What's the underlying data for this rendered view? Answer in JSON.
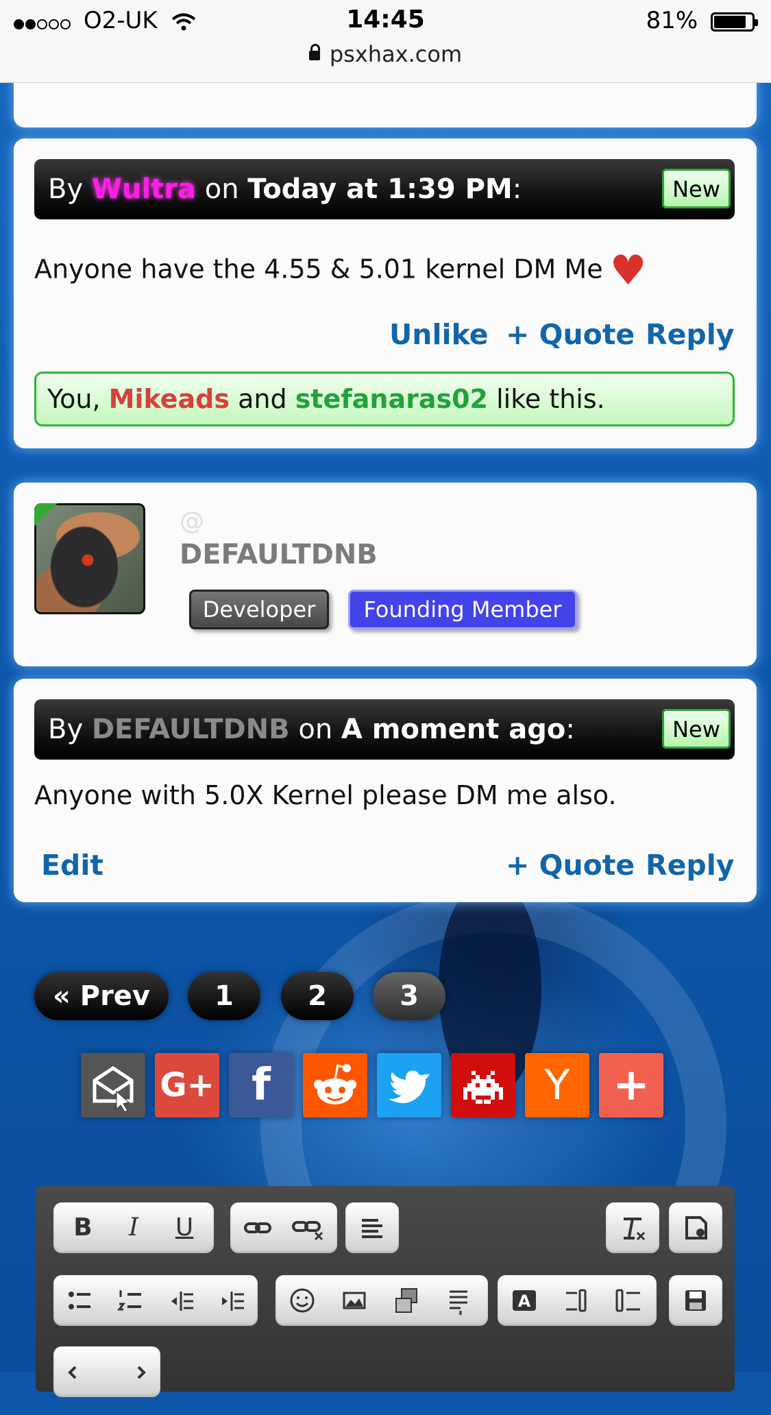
{
  "status_bar": {
    "carrier": "O2-UK",
    "time": "14:45",
    "battery": "81%",
    "url": "psxhax.com"
  },
  "post1": {
    "by": "By",
    "author": "Wultra",
    "on": "on",
    "when": "Today at 1:39 PM",
    "colon": ":",
    "badge": "New",
    "body": "Anyone have the 4.55 & 5.01 kernel DM Me",
    "actions": {
      "unlike": "Unlike",
      "quote": "+ Quote",
      "reply": "Reply"
    },
    "likes": {
      "prefix": "You,",
      "user1": "Mikeads",
      "and": "and",
      "user2": "stefanaras02",
      "suffix": "like this."
    }
  },
  "profile": {
    "at": "@",
    "name": "DEFAULTDNB",
    "roles": [
      "Developer",
      "Founding Member"
    ]
  },
  "post2": {
    "by": "By",
    "author": "DEFAULTDNB",
    "on": "on",
    "when": "A moment ago",
    "colon": ":",
    "badge": "New",
    "body": "Anyone with 5.0X Kernel please DM me also.",
    "actions": {
      "edit": "Edit",
      "quote": "+ Quote",
      "reply": "Reply"
    }
  },
  "pagination": {
    "prev": "« Prev",
    "pages": [
      "1",
      "2",
      "3"
    ],
    "current": "3"
  },
  "share_buttons": [
    {
      "name": "email-icon",
      "color": "#555555"
    },
    {
      "name": "google-plus-icon",
      "color": "#dc4a3e",
      "label": "G+"
    },
    {
      "name": "facebook-icon",
      "color": "#3b5998",
      "label": "f"
    },
    {
      "name": "reddit-icon",
      "color": "#ff5700"
    },
    {
      "name": "twitter-icon",
      "color": "#1da1f2"
    },
    {
      "name": "space-invader-icon",
      "color": "#d10e0e"
    },
    {
      "name": "hacker-news-icon",
      "color": "#ff6600",
      "label": "Y"
    },
    {
      "name": "more-icon",
      "color": "#f0604f",
      "label": "+"
    }
  ],
  "editor": {
    "bold": "B",
    "italic": "I",
    "underline": "U"
  }
}
